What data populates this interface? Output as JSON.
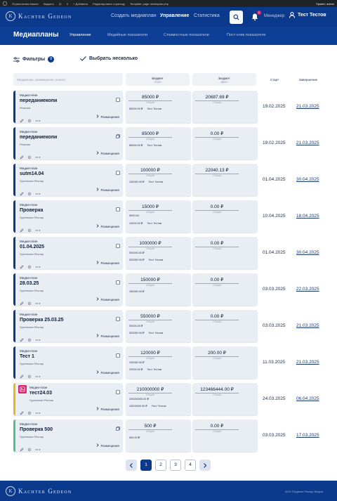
{
  "admin_bar": {
    "items": [
      "Ограничения Кашин",
      "Кадасть",
      "11",
      "0",
      "+ Добавить",
      "Редактировать страницу",
      "Template: page-mediaplan.php"
    ],
    "greeting": "Привет, admin"
  },
  "header": {
    "logo_mark": "K",
    "logo_text": "Kachter Gedeon",
    "nav": [
      "Создать медиаплан",
      "Управление",
      "Статистика"
    ],
    "active_nav": "Управление",
    "notifications_count": "1",
    "role": "Менеджер",
    "user_name": "Тест Тестов"
  },
  "subnav": {
    "title": "Медиапланы",
    "tabs": [
      "Управление",
      "Медийные показатели",
      "Стоимостные показатели",
      "Пост-клик показатели"
    ],
    "active_tab": "Управление"
  },
  "toolbar": {
    "filters_label": "Фильтры",
    "filters_count": "8",
    "multi_select_label": "Выбрать несколько"
  },
  "table": {
    "search_placeholder": "Медиаплан, размещение, клиент",
    "col_plan_title": "Бюджет",
    "col_plan_sub": "план",
    "col_fact_title": "Бюджет",
    "col_fact_sub": "факт",
    "col_start": "Старт",
    "col_end": "Завершение",
    "type_label": "Медиа-план",
    "placement_label": "Размещения",
    "total_label": "Общий"
  },
  "rows": [
    {
      "name": "переданиекопи",
      "client": "Ревизия",
      "plan": "85000 ₽",
      "fact": "20687.69 ₽",
      "lines": [
        {
          "amount": "85000.00 ₽",
          "who": "Тест Тестов"
        }
      ],
      "start": "19.02.2025",
      "end": "21.03.2025",
      "style": "default",
      "corner": "checkbox"
    },
    {
      "name": "переданиекопи",
      "client": "Ревизия",
      "plan": "85000 ₽",
      "fact": "0.00 ₽",
      "lines": [
        {
          "amount": "85000.00 ₽",
          "who": "Тест Тестов"
        }
      ],
      "start": "19.02.2025",
      "end": "21.03.2025",
      "style": "default",
      "corner": "copy"
    },
    {
      "name": "sutm14.04",
      "client": "Группвижн Реклар",
      "plan": "100000 ₽",
      "fact": "22040.13 ₽",
      "lines": [
        {
          "amount": "100000.00 ₽",
          "who": "Тест Тестов"
        }
      ],
      "start": "01.04.2025",
      "end": "30.04.2025",
      "style": "default",
      "corner": "checkbox"
    },
    {
      "name": "Проверка",
      "client": "Группвижн Реклар",
      "plan": "15000 ₽",
      "fact": "0.00 ₽",
      "lines": [
        {
          "amount": "5000.00",
          "who": ""
        },
        {
          "amount": "10000.00 ₽",
          "who": "Тест Тестов"
        }
      ],
      "start": "10.04.2025",
      "end": "18.04.2025",
      "style": "default",
      "corner": "checkbox"
    },
    {
      "name": "01.04.2025",
      "client": "Группвижн Реклар",
      "plan": "1000000 ₽",
      "fact": "0.00 ₽",
      "lines": [
        {
          "amount": "500000.00 ₽",
          "who": ""
        },
        {
          "amount": "500000.00 ₽",
          "who": "Тест Тестов"
        }
      ],
      "start": "01.04.2025",
      "end": "30.04.2025",
      "style": "default",
      "corner": "checkbox"
    },
    {
      "name": "28.03.25",
      "client": "Группвижн Реклар",
      "plan": "150000 ₽",
      "fact": "0.00 ₽",
      "lines": [
        {
          "amount": "150000.00 ₽",
          "who": ""
        }
      ],
      "start": "03.03.2025",
      "end": "22.03.2025",
      "style": "default",
      "corner": "checkbox"
    },
    {
      "name": "Проверка 25.03.25",
      "client": "Группвижн Реклар",
      "plan": "550000 ₽",
      "fact": "0.00 ₽",
      "lines": [
        {
          "amount": "50000.00 ₽",
          "who": ""
        },
        {
          "amount": "500000.00 ₽",
          "who": "Тест Тестов"
        }
      ],
      "start": "03.03.2025",
      "end": "21.03.2025",
      "style": "default",
      "corner": "checkbox"
    },
    {
      "name": "Тест 1",
      "client": "Группвижн Реклар",
      "plan": "120000 ₽",
      "fact": "200.00 ₽",
      "lines": [
        {
          "amount": "100000.00 ₽",
          "who": ""
        },
        {
          "amount": "20000.00 ₽",
          "who": "Тест Тестов"
        }
      ],
      "start": "11.03.2025",
      "end": "21.03.2025",
      "style": "default",
      "corner": "checkbox"
    },
    {
      "name": "тест24.03",
      "client": "Группвижн Реклар",
      "plan": "210000000 ₽",
      "fact": "123466444.00 ₽",
      "lines": [
        {
          "amount": "200000000.00 ₽",
          "who": ""
        },
        {
          "amount": "10000000.00 ₽",
          "who": "Тест Тестов"
        }
      ],
      "start": "24.03.2025",
      "end": "06.04.2025",
      "style": "thumb",
      "corner": "checkbox"
    },
    {
      "name": "Проверка 500",
      "client": "Группвижн Реклар",
      "plan": "500 ₽",
      "fact": "0.00 ₽",
      "lines": [
        {
          "amount": "500.00 ₽",
          "who": ""
        }
      ],
      "start": "03.03.2025",
      "end": "17.03.2025",
      "style": "green",
      "corner": "copy"
    }
  ],
  "pagination": {
    "pages": [
      "1",
      "2",
      "3",
      "4"
    ],
    "current": "1",
    "prev_icon": "chevron-left-icon",
    "next_icon": "chevron-right-icon"
  },
  "footer": {
    "copyright": "2025 ©Адвэнс Реклар Медиа"
  },
  "colors": {
    "brand": "#0b3a8c",
    "card": "#e9eef5",
    "thumb_accent": "#e4b91f",
    "green_accent": "#55c08c",
    "badge": "#e0245e"
  }
}
